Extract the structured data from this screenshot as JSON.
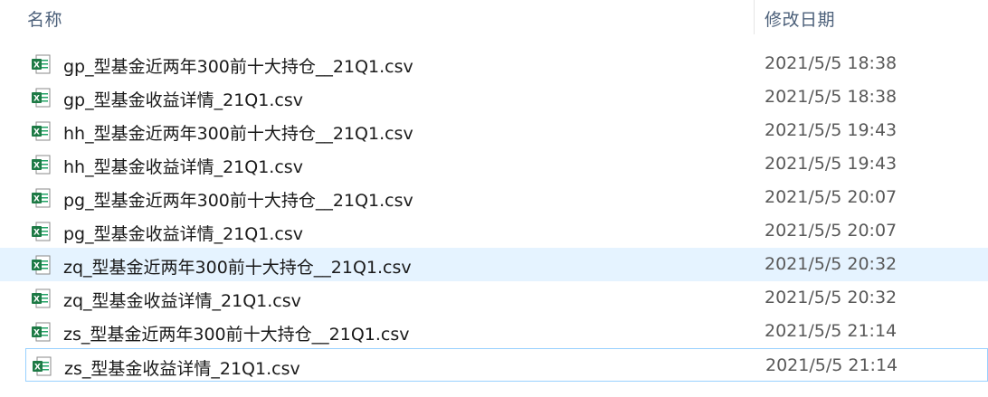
{
  "header": {
    "name_col": "名称",
    "date_col": "修改日期"
  },
  "files": [
    {
      "name": "gp_型基金近两年300前十大持仓__21Q1.csv",
      "date": "2021/5/5 18:38",
      "icon": "excel-csv-icon"
    },
    {
      "name": "gp_型基金收益详情_21Q1.csv",
      "date": "2021/5/5 18:38",
      "icon": "excel-csv-icon"
    },
    {
      "name": "hh_型基金近两年300前十大持仓__21Q1.csv",
      "date": "2021/5/5 19:43",
      "icon": "excel-csv-icon"
    },
    {
      "name": "hh_型基金收益详情_21Q1.csv",
      "date": "2021/5/5 19:43",
      "icon": "excel-csv-icon"
    },
    {
      "name": "pg_型基金近两年300前十大持仓__21Q1.csv",
      "date": "2021/5/5 20:07",
      "icon": "excel-csv-icon"
    },
    {
      "name": "pg_型基金收益详情_21Q1.csv",
      "date": "2021/5/5 20:07",
      "icon": "excel-csv-icon"
    },
    {
      "name": "zq_型基金近两年300前十大持仓__21Q1.csv",
      "date": "2021/5/5 20:32",
      "icon": "excel-csv-icon"
    },
    {
      "name": "zq_型基金收益详情_21Q1.csv",
      "date": "2021/5/5 20:32",
      "icon": "excel-csv-icon"
    },
    {
      "name": "zs_型基金近两年300前十大持仓__21Q1.csv",
      "date": "2021/5/5 21:14",
      "icon": "excel-csv-icon"
    },
    {
      "name": "zs_型基金收益详情_21Q1.csv",
      "date": "2021/5/5 21:14",
      "icon": "excel-csv-icon"
    }
  ],
  "colors": {
    "hover_row": "#e5f3ff",
    "focus_border": "#99d1ff",
    "excel_green": "#1d7a45"
  }
}
